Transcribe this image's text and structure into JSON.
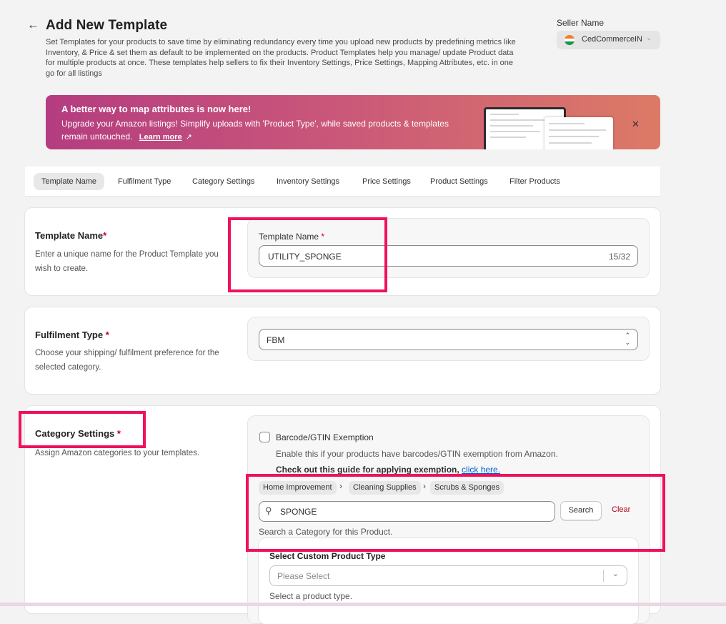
{
  "header": {
    "title": "Add New Template",
    "description": "Set Templates for your products to save time by eliminating redundancy every time you upload new products by predefining metrics like Inventory, & Price & set them as default to be implemented on the products. Product Templates help you manage/ update Product data for multiple products at once. These templates help sellers to fix their Inventory Settings, Price Settings, Mapping Attributes, etc. in one go for all listings",
    "seller_label": "Seller Name",
    "seller_value": "CedCommerceIN"
  },
  "banner": {
    "title": "A better way to map attributes is now here!",
    "text": "Upgrade your Amazon listings! Simplify uploads with 'Product Type', while saved products & templates remain untouched.",
    "link": "Learn more"
  },
  "tabs": [
    {
      "label": "Template Name"
    },
    {
      "label": "Fulfilment Type"
    },
    {
      "label": "Category Settings"
    },
    {
      "label": "Inventory Settings"
    },
    {
      "label": "Price Settings"
    },
    {
      "label": "Product Settings"
    },
    {
      "label": "Filter Products"
    }
  ],
  "template_name": {
    "title": "Template Name",
    "required": "*",
    "description": "Enter a unique name for the Product Template you wish to create.",
    "field_label": "Template Name",
    "value": "UTILITY_SPONGE",
    "counter": "15/32"
  },
  "fulfilment": {
    "title": "Fulfilment Type",
    "required": "*",
    "description": "Choose your shipping/ fulfilment preference for the selected category.",
    "value": "FBM"
  },
  "category": {
    "title": "Category Settings",
    "required": "*",
    "description": "Assign Amazon categories to your templates.",
    "barcode_label": "Barcode/GTIN Exemption",
    "barcode_help": "Enable this if your products have barcodes/GTIN exemption from Amazon.",
    "guide_text": "Check out this guide for applying exemption,",
    "guide_link": "click here.",
    "breadcrumb": [
      "Home Improvement",
      "Cleaning Supplies",
      "Scrubs & Sponges"
    ],
    "search_value": "SPONGE",
    "search_button": "Search",
    "clear_button": "Clear",
    "search_help": "Search a Category for this Product.",
    "custom_type_title": "Select Custom Product Type",
    "custom_type_placeholder": "Please Select",
    "custom_type_help": "Select a product type."
  },
  "colors": {
    "highlight": "#f0115d",
    "link": "#005bd3",
    "clear": "#b4001a"
  }
}
